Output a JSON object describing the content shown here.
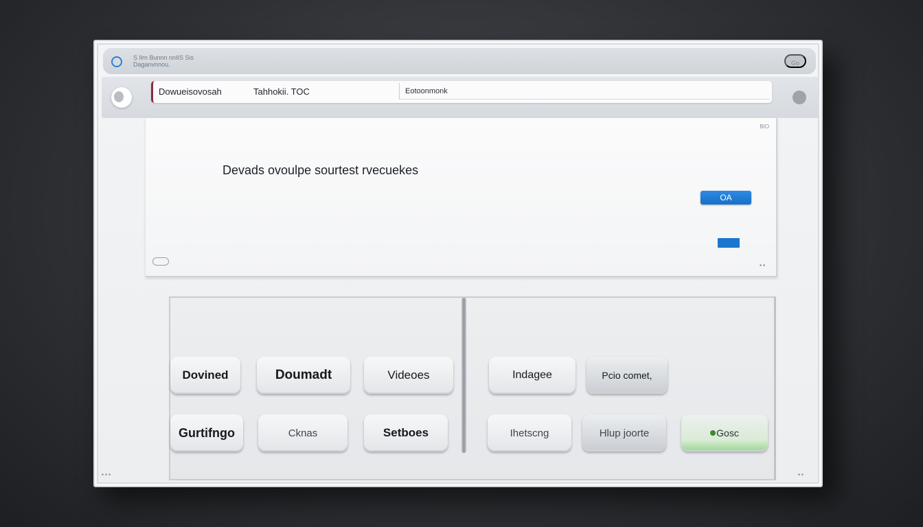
{
  "window": {
    "title": "S Ilrn Bunnn nnIIS Sis Daganvnnou.",
    "title_button": "Go"
  },
  "toolbar": {
    "address_segment_1": "Dowueisovosah",
    "address_segment_2": "Tahhokii. TOC",
    "address_input_value": "Eotoonmonk"
  },
  "panel": {
    "code": "BIO",
    "heading": "Devads ovoulpe sourtest rvecuekes",
    "primary_button": "OA",
    "corner_mark": "▪ ▪"
  },
  "tiles": {
    "row1": [
      "Dovined",
      "Doumadt",
      "Videoes",
      "Indagee",
      "Pcio comet,"
    ],
    "row2": [
      "Gurtifngo",
      "Cknas",
      "Setboes",
      "Ihetscng",
      "Hlup joorte",
      "Gosc"
    ]
  },
  "footer": {
    "left": "▪ ▪ ▪",
    "right": "▪ ▪"
  },
  "colors": {
    "accent": "#1a76cf",
    "success": "#96d88d"
  }
}
